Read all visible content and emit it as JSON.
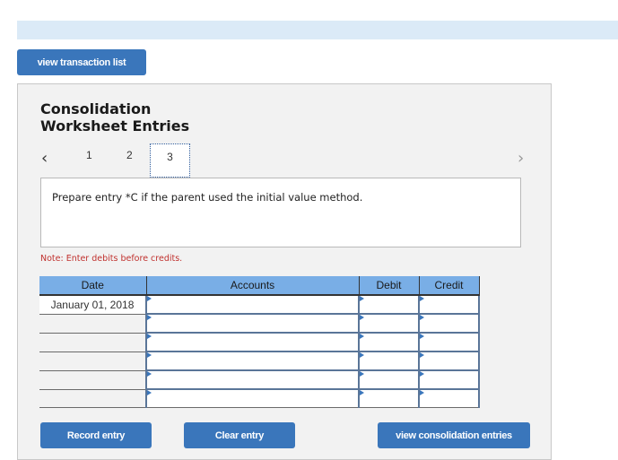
{
  "header": {
    "view_transaction_list_label": "view transaction list"
  },
  "panel": {
    "title_line1": "Consolidation",
    "title_line2": "Worksheet Entries",
    "nav": {
      "prev_icon": "‹",
      "next_icon": "›",
      "tabs": [
        {
          "label": "1",
          "active": false
        },
        {
          "label": "2",
          "active": false
        },
        {
          "label": "3",
          "active": true
        }
      ]
    },
    "prompt": "Prepare entry *C if the parent used the initial value method.",
    "note": "Note: Enter debits before credits.",
    "table": {
      "columns": [
        "Date",
        "Accounts",
        "Debit",
        "Credit"
      ],
      "rows": [
        {
          "date": "January 01, 2018",
          "account": "",
          "debit": "",
          "credit": ""
        },
        {
          "date": "",
          "account": "",
          "debit": "",
          "credit": ""
        },
        {
          "date": "",
          "account": "",
          "debit": "",
          "credit": ""
        },
        {
          "date": "",
          "account": "",
          "debit": "",
          "credit": ""
        },
        {
          "date": "",
          "account": "",
          "debit": "",
          "credit": ""
        },
        {
          "date": "",
          "account": "",
          "debit": "",
          "credit": ""
        }
      ]
    },
    "buttons": {
      "record": "Record entry",
      "clear": "Clear entry",
      "view_consolidation": "view consolidation entries"
    }
  },
  "colors": {
    "button_blue": "#3a76bb",
    "header_blue": "#79aee6",
    "top_bar": "#dbeaf7",
    "note_red": "#c0312e"
  }
}
